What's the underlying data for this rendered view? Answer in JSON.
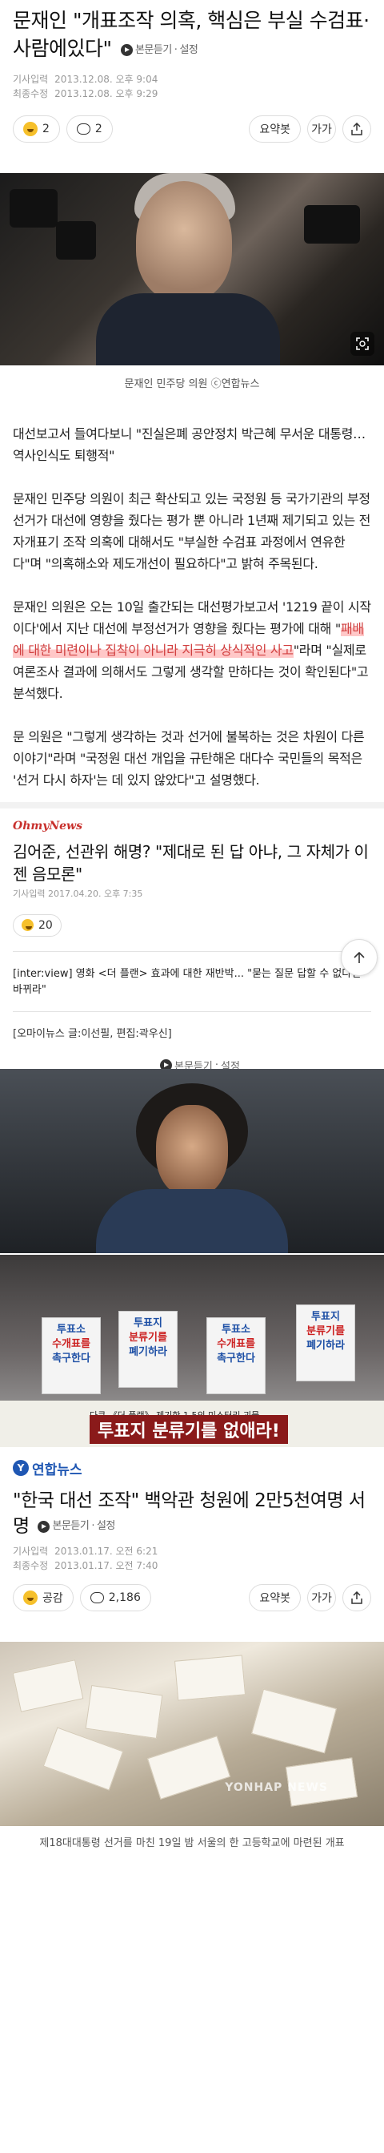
{
  "article1": {
    "title": "문재인 \"개표조작 의혹, 핵심은 부실 수검표·사람에있다\"",
    "listen_label": "본문듣기",
    "settings_label": "설정",
    "input_label": "기사입력",
    "input_date": "2013.12.08. 오후 9:04",
    "updated_label": "최종수정",
    "updated_date": "2013.12.08. 오후 9:29",
    "reaction_count": "2",
    "comment_count": "2",
    "summary_label": "요약봇",
    "font_label": "가가",
    "photo_caption": "문재인 민주당 의원 ⓒ연합뉴스",
    "paragraphs": [
      "대선보고서 들여다보니 \"진실은폐 공안정치 박근혜 무서운 대통령…역사인식도 퇴행적\"",
      "문재인 민주당 의원이 최근 확산되고 있는 국정원 등 국가기관의 부정선거가 대선에 영향을 줬다는 평가 뿐 아니라 1년째 제기되고 있는 전자개표기 조작 의혹에 대해서도 \"부실한 수검표 과정에서 연유한다\"며 \"의혹해소와 제도개선이 필요하다\"고 밝혀 주목된다."
    ],
    "p3_before": "문재인 의원은 오는 10일 출간되는 대선평가보고서 '1219 끝이 시작이다'에서 지난 대선에 부정선거가 영향을 줬다는 평가에 대해 \"",
    "p3_highlight": "패배에 대한 미련이나 집착이 아니라 지극히 상식적인 사고",
    "p3_after": "\"라며 \"실제로 여론조사 결과에 의해서도 그렇게 생각할 만하다는 것이 확인된다\"고 분석했다.",
    "p4": "문 의원은 \"그렇게 생각하는 것과 선거에 불복하는 것은 차원이 다른 이야기\"라며 \"국정원 대선 개입을 규탄해온 대다수 국민들의 목적은 '선거 다시 하자'는 데 있지 않았다\"고 설명했다."
  },
  "article2": {
    "logo": "OhmyNews",
    "title": "김어준, 선관위 해명? \"제대로 된 답 아냐, 그 자체가 이젠 음모론\"",
    "listen_label": "본문듣기",
    "settings_label": "설정",
    "meta": "기사입력 2017.04.20. 오후 7:35",
    "reaction_count": "20",
    "related": "[inter:view] 영화 <더 플랜> 효과에 대한 재반박... \"묻는 질문 답할 수 없다면 바뀌라\"",
    "source": "[오마이뉴스 글:이선필, 편집:곽우신]",
    "sign1_a": "투표소",
    "sign1_b": "수개표를",
    "sign1_c": "촉구한다",
    "sign2_a": "투표지",
    "sign2_b": "분류기를",
    "sign2_c": "폐기하라",
    "sign3_a": "투표소",
    "sign3_b": "수개표를",
    "sign3_c": "촉구한다",
    "sign4_a": "투표지",
    "sign4_b": "분류기를",
    "sign4_c": "폐기하라",
    "banner_small": "다큐 《더 플랜》 제기한 1.5의 미스터리 괴물",
    "banner_text": "투표지 분류기를 없애라!"
  },
  "article3": {
    "logo": "연합뉴스",
    "title": "\"한국 대선 조작\" 백악관 청원에 2만5천여명 서명",
    "listen_label": "본문듣기",
    "settings_label": "설정",
    "input_label": "기사입력",
    "input_date": "2013.01.17. 오전 6:21",
    "updated_label": "최종수정",
    "updated_date": "2013.01.17. 오전 7:40",
    "like_label": "공감",
    "comment_count": "2,186",
    "summary_label": "요약봇",
    "font_label": "가가",
    "watermark": "YONHAP NEWS",
    "caption": "제18대대통령 선거를 마친 19일 밤 서울의 한 고등학교에 마련된 개표"
  },
  "colors": {
    "highlight": "#d14040",
    "ohmy_red": "#c8302c",
    "yonhap_blue": "#1f57b3"
  }
}
